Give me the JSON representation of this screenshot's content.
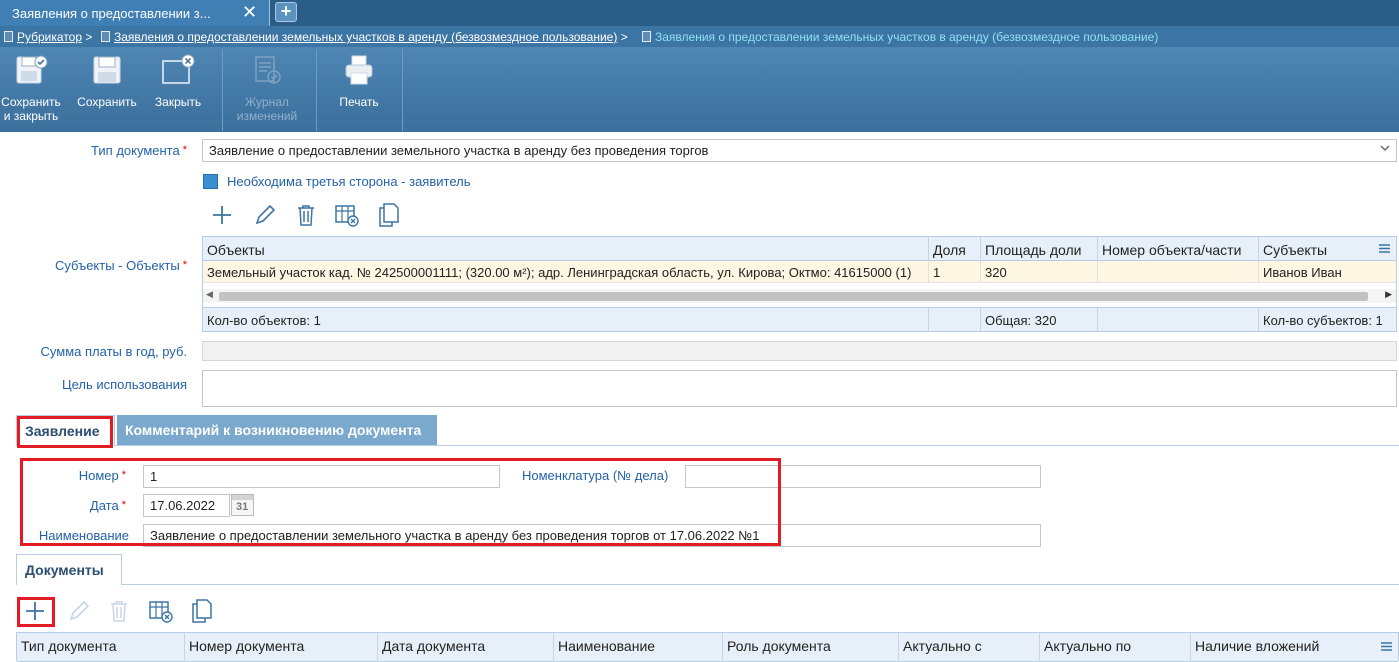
{
  "window": {
    "tab_title": "Заявления о предоставлении з...",
    "close_symbol": "✕",
    "new_tab_symbol": "+"
  },
  "breadcrumb": {
    "items": [
      "Рубрикатор",
      "Заявления о предоставлении земельных участков в аренду (безвозмездное пользование)"
    ],
    "separator": ">",
    "current": "Заявления о предоставлении земельных участков в аренду (безвозмездное пользование)"
  },
  "toolbar": {
    "save_close": "Сохранить\nи закрыть",
    "save": "Сохранить",
    "close": "Закрыть",
    "journal": "Журнал\nизменений",
    "print": "Печать"
  },
  "form": {
    "doc_type_label": "Тип документа",
    "doc_type_value": "Заявление о предоставлении земельного участка в аренду без проведения торгов",
    "third_party_label": "Необходима третья сторона - заявитель",
    "subjects_label": "Субъекты - Объекты",
    "payment_label": "Сумма платы в год, руб.",
    "payment_value": "",
    "purpose_label": "Цель использования",
    "purpose_value": ""
  },
  "objects_grid": {
    "headers": [
      "Объекты",
      "Доля",
      "Площадь доли",
      "Номер объекта/части",
      "Субъекты"
    ],
    "row": [
      "Земельный участок кад. № 242500001111; (320.00 м²); адр. Ленинградская область, ул. Кирова; Октмо: 41615000 (1)",
      "1",
      "320",
      "",
      "Иванов Иван"
    ],
    "footer": {
      "count": "Кол-во объектов: 1",
      "total": "Общая: 320",
      "subjects": "Кол-во субъектов: 1"
    }
  },
  "tabs": {
    "statement": "Заявление",
    "comment": "Комментарий к возникновению документа"
  },
  "statement": {
    "number_label": "Номер",
    "number_value": "1",
    "nomenclature_label": "Номенклатура (№ дела)",
    "nomenclature_value": "",
    "date_label": "Дата",
    "date_value": "17.06.2022",
    "calendar_day": "31",
    "name_label": "Наименование",
    "name_value": "Заявление о предоставлении земельного участка в аренду без проведения торгов от 17.06.2022 №1"
  },
  "documents": {
    "tab_label": "Документы",
    "headers": [
      "Тип документа",
      "Номер документа",
      "Дата документа",
      "Наименование",
      "Роль документа",
      "Актуально с",
      "Актуально по",
      "Наличие вложений"
    ]
  },
  "colors": {
    "accent": "#3c74a3",
    "label_blue": "#2462a8",
    "highlight_red": "#e31b23"
  },
  "icons": [
    "plus-icon",
    "pencil-icon",
    "trash-icon",
    "table-delete-icon",
    "copy-icon",
    "save-close-icon",
    "save-icon",
    "close-window-icon",
    "journal-icon",
    "printer-icon",
    "calendar-icon",
    "chevron-down-icon",
    "menu-icon"
  ]
}
